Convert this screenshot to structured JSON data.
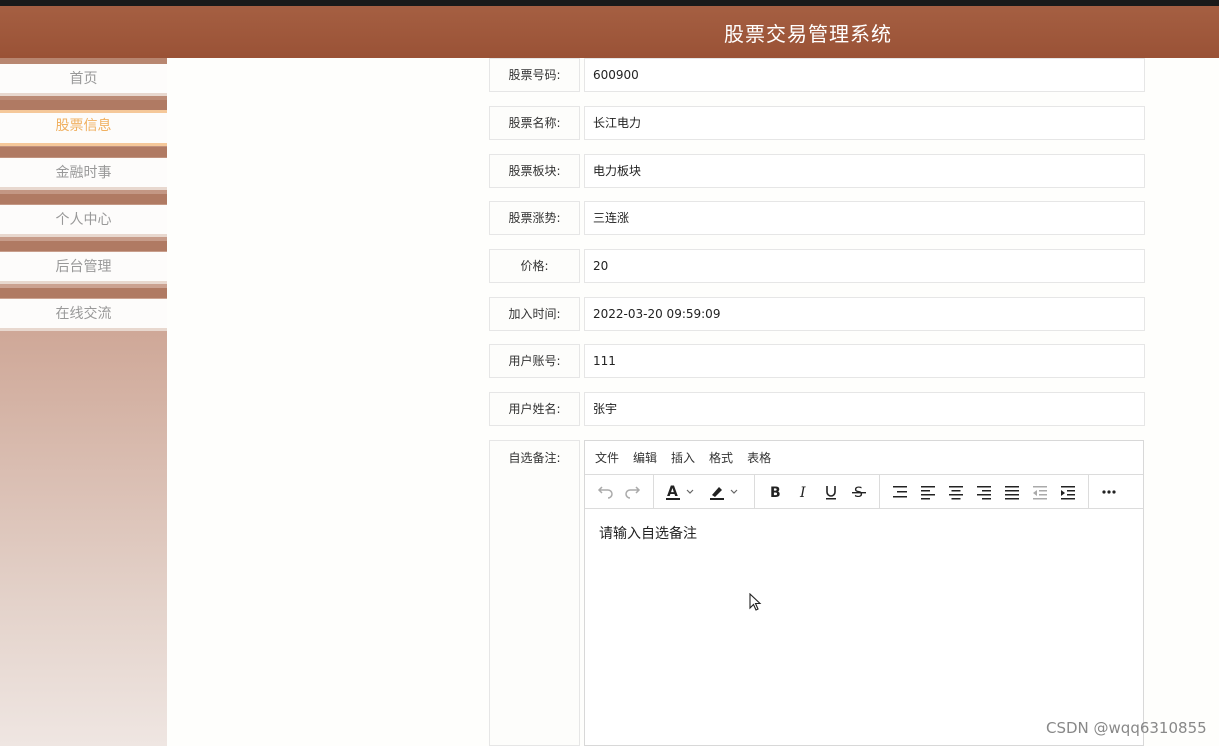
{
  "header": {
    "title": "股票交易管理系统"
  },
  "sidebar": {
    "items": [
      {
        "label": "首页"
      },
      {
        "label": "股票信息"
      },
      {
        "label": "金融时事"
      },
      {
        "label": "个人中心"
      },
      {
        "label": "后台管理"
      },
      {
        "label": "在线交流"
      }
    ],
    "active_index": 1
  },
  "form": {
    "fields": [
      {
        "label": "股票号码:",
        "value": "600900"
      },
      {
        "label": "股票名称:",
        "value": "长江电力"
      },
      {
        "label": "股票板块:",
        "value": "电力板块"
      },
      {
        "label": "股票涨势:",
        "value": "三连涨"
      },
      {
        "label": "价格:",
        "value": "20"
      },
      {
        "label": "加入时间:",
        "value": "2022-03-20 09:59:09"
      },
      {
        "label": "用户账号:",
        "value": "111"
      },
      {
        "label": "用户姓名:",
        "value": "张宇"
      }
    ],
    "note_label": "自选备注:"
  },
  "editor": {
    "menu": [
      "文件",
      "编辑",
      "插入",
      "格式",
      "表格"
    ],
    "placeholder": "请输入自选备注",
    "toolbar_icons": [
      "undo-icon",
      "redo-icon",
      "text-color-icon",
      "highlight-color-icon",
      "bold-icon",
      "italic-icon",
      "underline-icon",
      "strikethrough-icon",
      "line-height-icon",
      "align-left-icon",
      "align-center-icon",
      "align-right-icon",
      "align-justify-icon",
      "outdent-icon",
      "indent-icon",
      "more-icon"
    ]
  },
  "watermark": "CSDN @wqq6310855",
  "colors": {
    "header": "#a0593c",
    "active_nav": "#f0b060"
  }
}
